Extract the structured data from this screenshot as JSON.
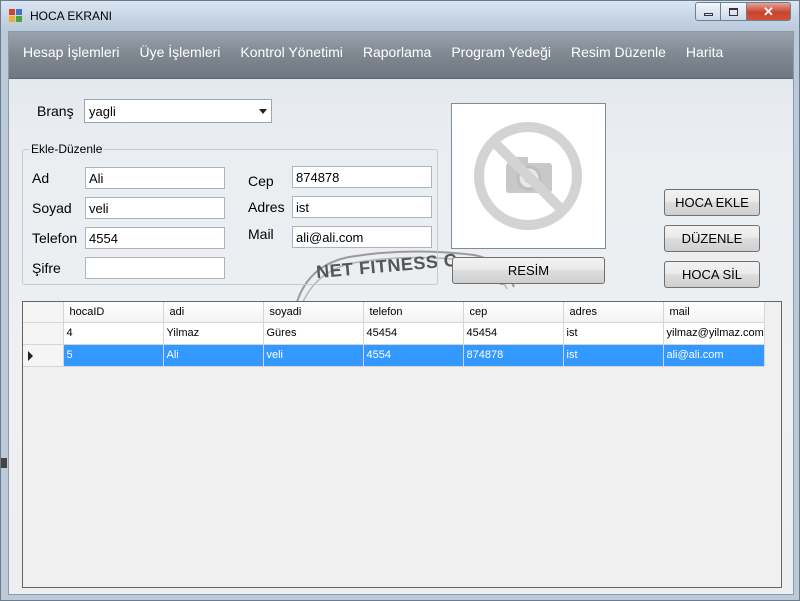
{
  "window": {
    "title": "HOCA EKRANI",
    "controls": {
      "minimize": "▭",
      "maximize": "□",
      "close": "✕"
    }
  },
  "menu": {
    "items": [
      "Hesap İşlemleri",
      "Üye İşlemleri",
      "Kontrol Yönetimi",
      "Raporlama",
      "Program Yedeği",
      "Resim Düzenle",
      "Harita"
    ]
  },
  "brans": {
    "label": "Branş",
    "value": "yagli"
  },
  "group": {
    "title": "Ekle-Düzenle",
    "ad_label": "Ad",
    "ad_value": "Ali",
    "soyad_label": "Soyad",
    "soyad_value": "veli",
    "telefon_label": "Telefon",
    "telefon_value": "4554",
    "sifre_label": "Şifre",
    "sifre_value": "",
    "cep_label": "Cep",
    "cep_value": "874878",
    "adres_label": "Adres",
    "adres_value": "ist",
    "mail_label": "Mail",
    "mail_value": "ali@ali.com"
  },
  "watermark_text": "NET FITNESS C",
  "buttons": {
    "resim": "RESİM",
    "hoca_ekle": "HOCA EKLE",
    "duzenle": "DÜZENLE",
    "hoca_sil": "HOCA SİL"
  },
  "grid": {
    "columns": [
      "hocaID",
      "adi",
      "soyadi",
      "telefon",
      "cep",
      "adres",
      "mail"
    ],
    "rows": [
      [
        "4",
        "Yilmaz",
        "Güres",
        "45454",
        "45454",
        "ist",
        "yilmaz@yilmaz.com"
      ],
      [
        "5",
        "Ali",
        "veli",
        "4554",
        "874878",
        "ist",
        "ali@ali.com"
      ]
    ],
    "selected_row": 1
  },
  "colors": {
    "selection": "#3399ff",
    "menubar": "#7f8890",
    "close": "#c7432b"
  }
}
